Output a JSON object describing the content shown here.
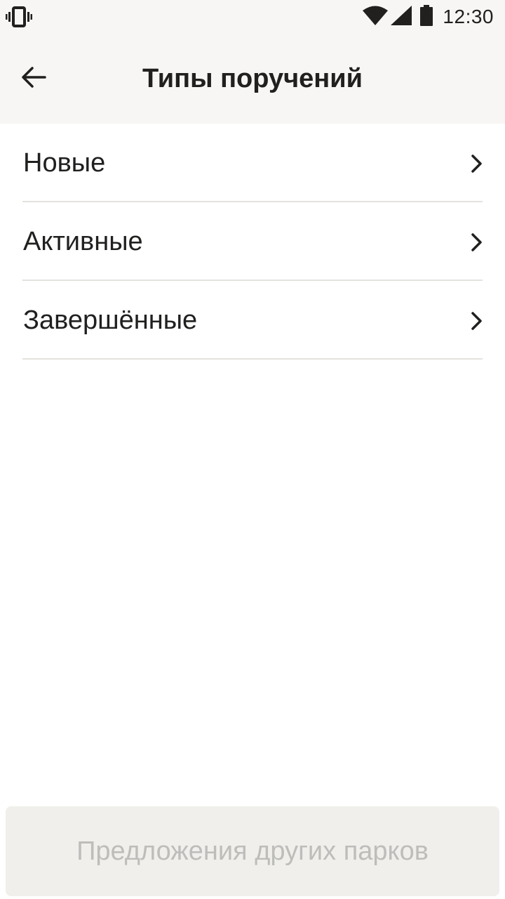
{
  "status_bar": {
    "time": "12:30",
    "icons": [
      "vibrate-icon",
      "wifi-icon",
      "signal-icon",
      "battery-icon"
    ]
  },
  "app_bar": {
    "title": "Типы поручений",
    "back_icon": "arrow-left-icon"
  },
  "list": {
    "items": [
      {
        "label": "Новые",
        "icon": "chevron-right-icon"
      },
      {
        "label": "Активные",
        "icon": "chevron-right-icon"
      },
      {
        "label": "Завершённые",
        "icon": "chevron-right-icon"
      }
    ]
  },
  "bottom_button": {
    "label": "Предложения других парков",
    "enabled": false
  },
  "colors": {
    "header_bg": "#f7f6f4",
    "text": "#21201f",
    "divider": "#e4e2de",
    "disabled_button_bg": "#f0efeb",
    "disabled_button_text": "#bebdbb"
  }
}
